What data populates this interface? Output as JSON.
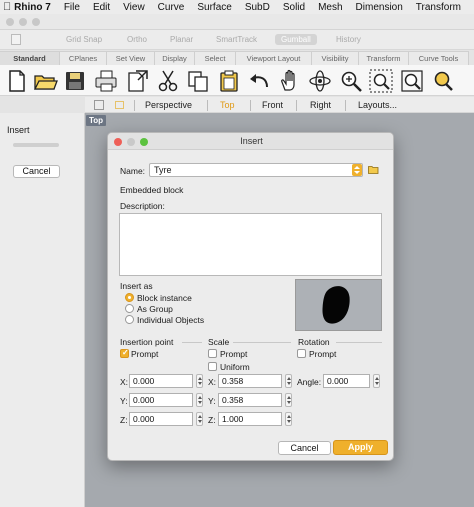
{
  "menubar": {
    "app": "Rhino 7",
    "items": [
      "File",
      "Edit",
      "View",
      "Curve",
      "Surface",
      "SubD",
      "Solid",
      "Mesh",
      "Dimension",
      "Transform"
    ]
  },
  "toggles": [
    "Grid Snap",
    "Ortho",
    "Planar",
    "SmartTrack",
    "Gumball",
    "History"
  ],
  "tabs": [
    "Standard",
    "CPlanes",
    "Set View",
    "Display",
    "Select",
    "Viewport Layout",
    "Visibility",
    "Transform",
    "Curve Tools"
  ],
  "toolbar_icons": [
    "new-file-icon",
    "open-folder-icon",
    "save-icon",
    "print-icon",
    "import-icon",
    "cut-icon",
    "copy-icon",
    "paste-icon",
    "undo-icon",
    "pan-hand-icon",
    "rotate-view-icon",
    "zoom-icon",
    "zoom-window-icon",
    "zoom-extents-icon",
    "zoom-selected-icon"
  ],
  "viewport_tabs": {
    "items": [
      "Perspective",
      "Top",
      "Front",
      "Right",
      "Layouts..."
    ],
    "active": "Top"
  },
  "viewport_label": "Top",
  "left_panel": {
    "title": "Insert",
    "cancel": "Cancel"
  },
  "dialog": {
    "title": "Insert",
    "name_label": "Name:",
    "name_value": "Tyre",
    "embedded": "Embedded block",
    "description_label": "Description:",
    "insert_as_label": "Insert as",
    "insert_as_options": [
      {
        "label": "Block instance",
        "checked": true
      },
      {
        "label": "As Group",
        "checked": false
      },
      {
        "label": "Individual Objects",
        "checked": false
      }
    ],
    "insertion_point": {
      "title": "Insertion point",
      "prompt": "Prompt",
      "prompt_checked": true,
      "x_label": "X:",
      "x": "0.000",
      "y_label": "Y:",
      "y": "0.000",
      "z_label": "Z:",
      "z": "0.000"
    },
    "scale": {
      "title": "Scale",
      "prompt": "Prompt",
      "prompt_checked": false,
      "uniform": "Uniform",
      "uniform_checked": false,
      "x_label": "X:",
      "x": "0.358",
      "y_label": "Y:",
      "y": "0.358",
      "z_label": "Z:",
      "z": "1.000"
    },
    "rotation": {
      "title": "Rotation",
      "prompt": "Prompt",
      "prompt_checked": false,
      "angle_label": "Angle:",
      "angle": "0.000"
    },
    "cancel": "Cancel",
    "apply": "Apply"
  },
  "colors": {
    "accent": "#efb02c",
    "viewport_bg": "#a5a9ae",
    "viewport_label_bg": "#6d7684"
  }
}
